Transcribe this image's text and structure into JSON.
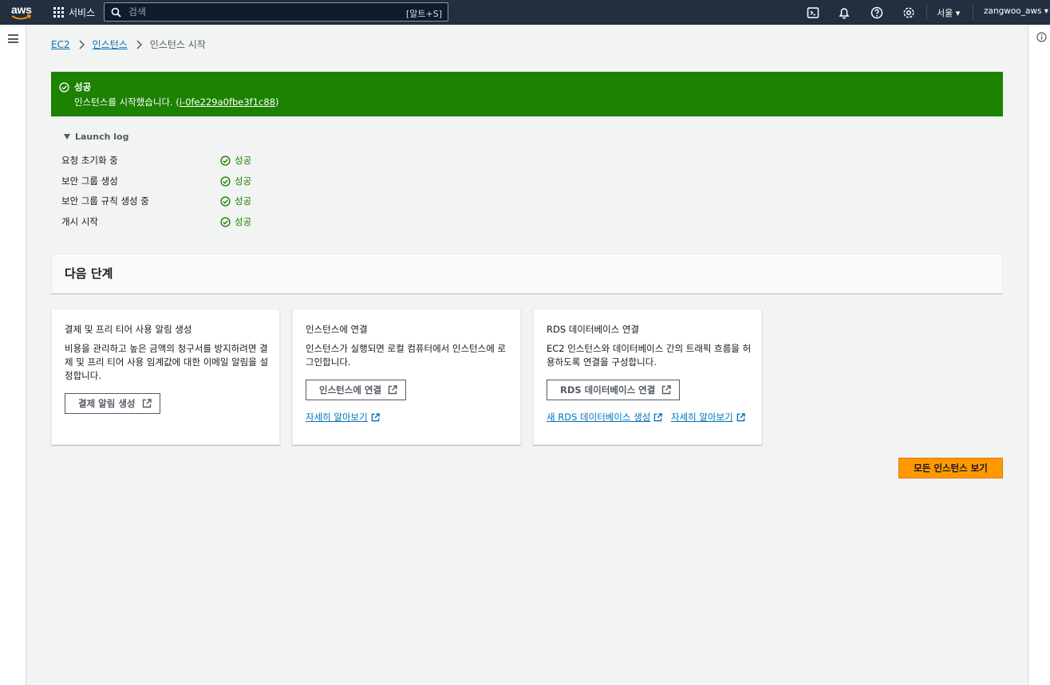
{
  "topnav": {
    "logo_text": "aws",
    "services_label": "서비스",
    "search_placeholder": "검색",
    "search_shortcut": "[알트+S]",
    "region_label": "서울 ▾",
    "user_label": "zangwoo_aws ▾"
  },
  "breadcrumb": {
    "items": [
      "EC2",
      "인스턴스"
    ],
    "current": "인스턴스 시작"
  },
  "flash": {
    "title": "성공",
    "message_prefix": "인스턴스를 시작했습니다. (",
    "instance_id": "i-0fe229a0fbe3f1c88",
    "message_suffix": ")",
    "color": "#1d8102"
  },
  "launch_log": {
    "title": "Launch log",
    "rows": [
      {
        "label": "요청 초기화 중",
        "status": "성공"
      },
      {
        "label": "보안 그룹 생성",
        "status": "성공"
      },
      {
        "label": "보안 그룹 규칙 생성 중",
        "status": "성공"
      },
      {
        "label": "개시 시작",
        "status": "성공"
      }
    ]
  },
  "next_steps": {
    "title": "다음 단계",
    "cards": [
      {
        "title": "결제 및 프리 티어 사용 알림 생성",
        "description": "비용을 관리하고 높은 금액의 청구서를 방지하려면 결제 및 프리 티어 사용 임계값에 대한 이메일 알림을 설정합니다.",
        "button": "결제 알림 생성"
      },
      {
        "title": "인스턴스에 연결",
        "description": "인스턴스가 실행되면 로컬 컴퓨터에서 인스턴스에 로그인합니다.",
        "button": "인스턴스에 연결",
        "links": [
          "자세히 알아보기"
        ]
      },
      {
        "title": "RDS 데이터베이스 연결",
        "description": "EC2 인스턴스와 데이터베이스 간의 트래픽 흐름을 허용하도록 연결을 구성합니다.",
        "button": "RDS 데이터베이스 연결",
        "links": [
          "새 RDS 데이터베이스 생성",
          "자세히 알아보기"
        ]
      }
    ]
  },
  "primary_button": "모든 인스턴스 보기",
  "colors": {
    "nav_bg": "#232f3e",
    "link": "#0073bb",
    "success": "#1d8102",
    "primary": "#ff9900"
  }
}
